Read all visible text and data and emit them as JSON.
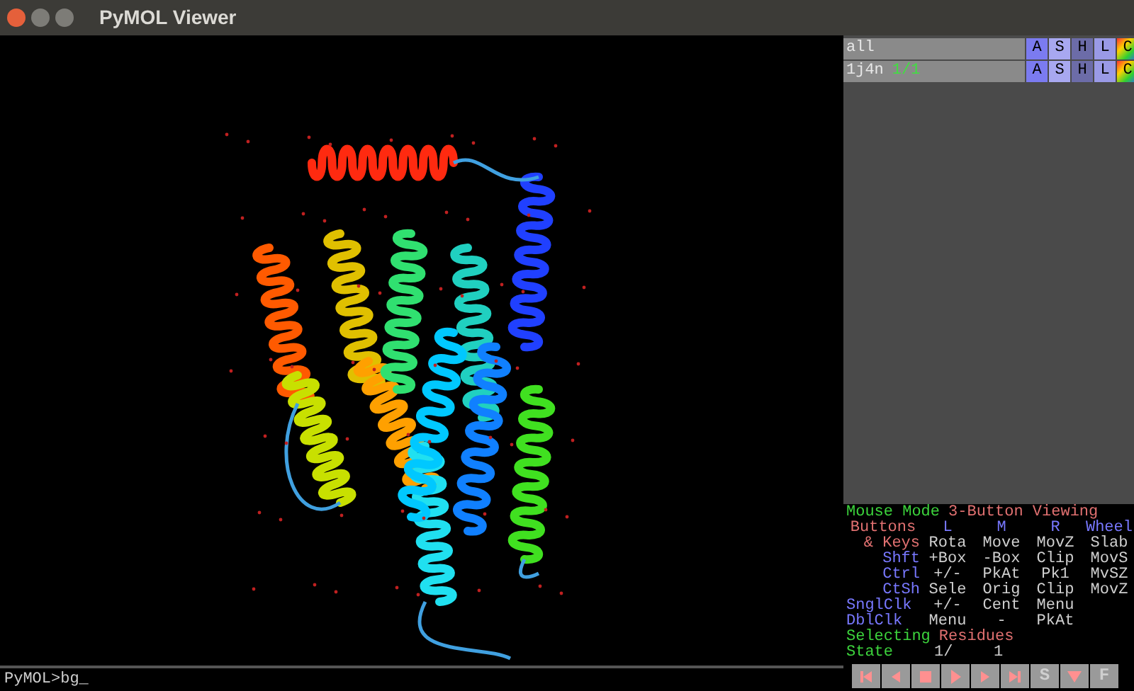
{
  "window": {
    "title": "PyMOL Viewer"
  },
  "objects": [
    {
      "name": "all",
      "buttons": [
        "A",
        "S",
        "H",
        "L",
        "C"
      ]
    },
    {
      "name": "1j4n",
      "state": "1/1",
      "buttons": [
        "A",
        "S",
        "H",
        "L",
        "C"
      ]
    }
  ],
  "mouse": {
    "label": "Mouse Mode",
    "mode": "3-Button Viewing",
    "header": {
      "key": "Buttons",
      "columns": [
        "L",
        "M",
        "R",
        "Wheel"
      ]
    },
    "rows": [
      {
        "key": "& Keys",
        "kind": "keys",
        "cells": [
          "Rota",
          "Move",
          "MovZ",
          "Slab"
        ]
      },
      {
        "key": "Shft",
        "kind": "modifier",
        "cells": [
          "+Box",
          "-Box",
          "Clip",
          "MovS"
        ]
      },
      {
        "key": "Ctrl",
        "kind": "modifier",
        "cells": [
          "+/-",
          "PkAt",
          "Pk1",
          "MvSZ"
        ]
      },
      {
        "key": "CtSh",
        "kind": "modifier",
        "cells": [
          "Sele",
          "Orig",
          "Clip",
          "MovZ"
        ]
      },
      {
        "key": "SnglClk",
        "kind": "click",
        "cells": [
          "+/-",
          "Cent",
          "Menu"
        ]
      },
      {
        "key": "DblClk",
        "kind": "click",
        "cells": [
          "Menu",
          "-",
          "PkAt"
        ]
      }
    ],
    "selecting": {
      "label": "Selecting",
      "value": "Residues"
    },
    "state": {
      "label": "State",
      "current": "1/",
      "total": "1"
    }
  },
  "playback": [
    {
      "kind": "first"
    },
    {
      "kind": "prev"
    },
    {
      "kind": "stop"
    },
    {
      "kind": "play"
    },
    {
      "kind": "next"
    },
    {
      "kind": "last"
    },
    {
      "kind": "text",
      "label": "S"
    },
    {
      "kind": "down"
    },
    {
      "kind": "text",
      "label": "F"
    }
  ],
  "command_line": {
    "value": "PyMOL>bg_"
  }
}
